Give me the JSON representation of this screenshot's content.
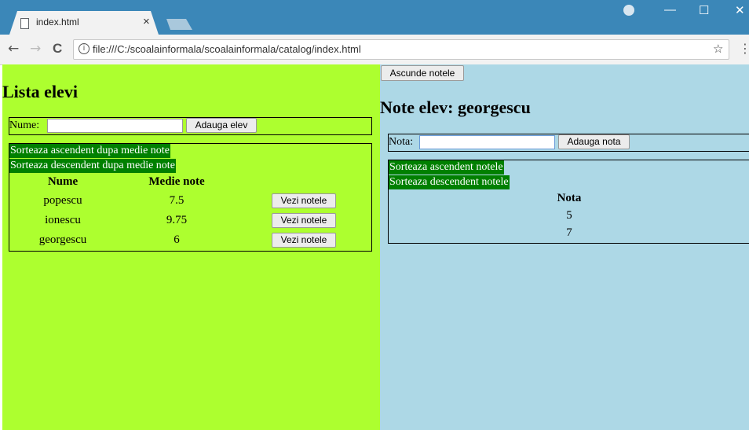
{
  "browser": {
    "tab_title": "index.html",
    "tab_close": "×",
    "address": "file:///C:/scoalainformala/scoalainformala/catalog/index.html",
    "window_controls": {
      "minimize": "—",
      "maximize": "☐",
      "close": "✕"
    },
    "nav": {
      "back": "←",
      "forward": "→",
      "reload": "C",
      "info": "i",
      "star": "☆",
      "menu": "⋮"
    }
  },
  "left": {
    "background": "#adff2f",
    "title": "Lista elevi",
    "name_label": "Nume:",
    "name_value": "",
    "add_button": "Adauga elev",
    "sort_asc": "Sorteaza ascendent dupa medie note",
    "sort_desc": "Sorteaza descendent dupa medie note",
    "columns": {
      "name": "Nume",
      "average": "Medie note"
    },
    "students": [
      {
        "name": "popescu",
        "average": "7.5",
        "action": "Vezi notele"
      },
      {
        "name": "ionescu",
        "average": "9.75",
        "action": "Vezi notele"
      },
      {
        "name": "georgescu",
        "average": "6",
        "action": "Vezi notele"
      }
    ]
  },
  "right": {
    "background": "#add8e6",
    "hide_button": "Ascunde notele",
    "title": "Note elev: georgescu",
    "grade_label": "Nota:",
    "grade_value": "",
    "add_button": "Adauga nota",
    "sort_asc": "Sorteaza ascendent notele",
    "sort_desc": "Sorteaza descendent notele",
    "column": "Nota",
    "grades": [
      "5",
      "7"
    ]
  },
  "colors": {
    "link_bg": "#008000",
    "chrome_blue": "#3b87b8"
  }
}
